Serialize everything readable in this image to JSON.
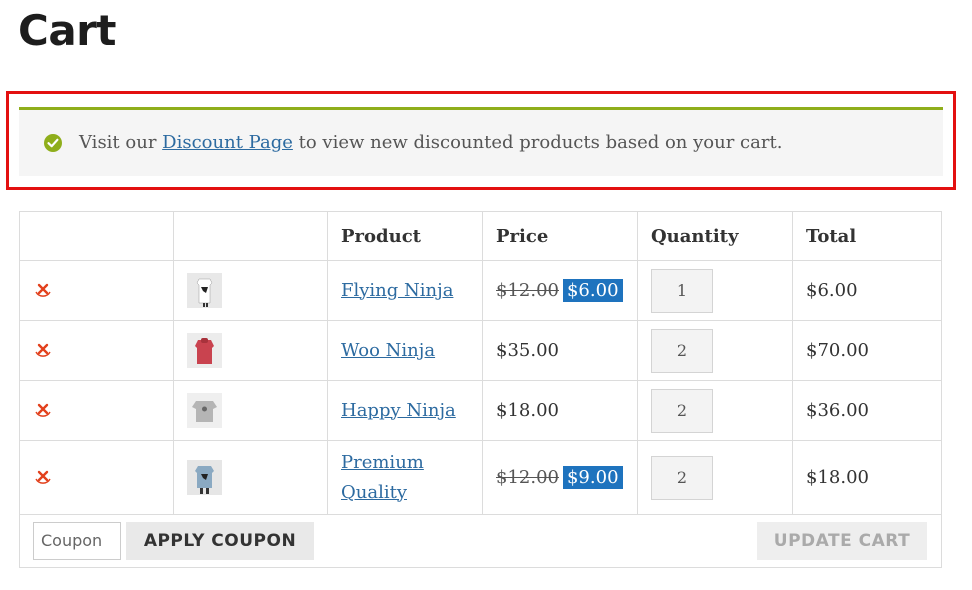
{
  "page": {
    "title": "Cart"
  },
  "notice": {
    "prefix": "Visit our",
    "link_text": "Discount Page",
    "suffix": "to view new discounted products based on your cart.",
    "accent": "#8fae1b"
  },
  "table": {
    "headers": [
      "",
      "",
      "Product",
      "Price",
      "Quantity",
      "Total"
    ],
    "rows": [
      {
        "product": "Flying Ninja",
        "price_old": "$12.00",
        "price": "$6.00",
        "qty": "1",
        "total": "$6.00",
        "thumb_color": "#ffffff"
      },
      {
        "product": "Woo Ninja",
        "price": "$35.00",
        "qty": "2",
        "total": "$70.00",
        "thumb_color": "#c9434f"
      },
      {
        "product": "Happy Ninja",
        "price": "$18.00",
        "qty": "2",
        "total": "$36.00",
        "thumb_color": "#b5b5b5"
      },
      {
        "product_line1": "Premium",
        "product_line2": "Quality",
        "price_old": "$12.00",
        "price": "$9.00",
        "qty": "2",
        "total": "$18.00",
        "thumb_color": "#8aa9c2"
      }
    ]
  },
  "actions": {
    "coupon_placeholder": "Coupon",
    "apply_label": "APPLY COUPON",
    "update_label": "UPDATE CART"
  },
  "colors": {
    "highlight": "#e31010",
    "sale": "#1e73be",
    "link": "#2c6aa0"
  }
}
